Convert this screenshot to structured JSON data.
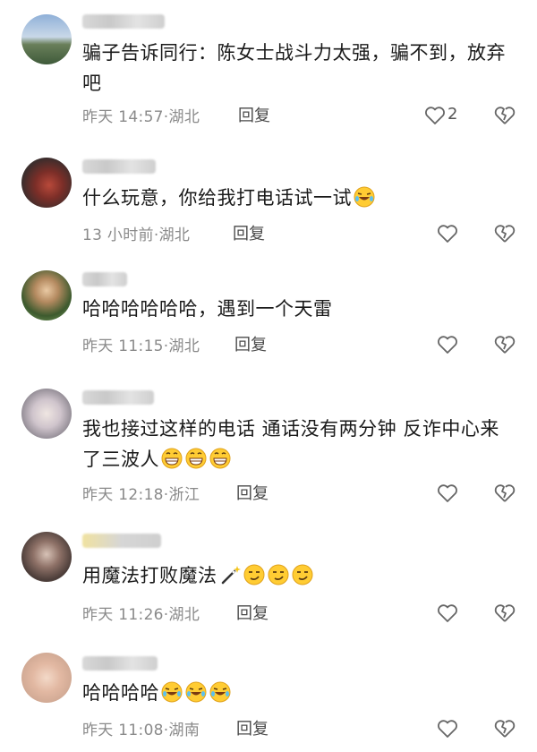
{
  "comments": [
    {
      "text": "骗子告诉同行：陈女士战斗力太强，骗不到，放弃吧",
      "time": "昨天 14:57",
      "location": "湖北",
      "reply": "回复",
      "likes": "2",
      "emojis": []
    },
    {
      "text": "什么玩意，你给我打电话试一试",
      "time": "13 小时前",
      "location": "湖北",
      "reply": "回复",
      "likes": "",
      "emojis": [
        "rofl-face-icon"
      ]
    },
    {
      "text": "哈哈哈哈哈哈，遇到一个天雷",
      "time": "昨天 11:15",
      "location": "湖北",
      "reply": "回复",
      "likes": "",
      "emojis": []
    },
    {
      "text": "我也接过这样的电话 通话没有两分钟 反诈中心来了三波人",
      "time": "昨天 12:18",
      "location": "浙江",
      "reply": "回复",
      "likes": "",
      "emojis": [
        "grinning-face-icon",
        "grinning-face-icon",
        "grinning-face-icon"
      ]
    },
    {
      "text": "用魔法打败魔法",
      "time": "昨天 11:26",
      "location": "湖北",
      "reply": "回复",
      "likes": "",
      "emojis": [
        "magic-wand-icon",
        "smirk-face-icon",
        "smirk-face-icon",
        "smirk-face-icon"
      ]
    },
    {
      "text": "哈哈哈哈",
      "time": "昨天 11:08",
      "location": "湖南",
      "reply": "回复",
      "likes": "",
      "emojis": [
        "rofl-face-icon",
        "rofl-face-icon",
        "rofl-face-icon"
      ]
    }
  ],
  "meta_separator": "·",
  "icons": {
    "like": "heart-outline-icon",
    "dislike": "broken-heart-icon"
  },
  "colors": {
    "text": "#1a1a1a",
    "meta": "#8a8a8a",
    "icon": "#666666"
  }
}
